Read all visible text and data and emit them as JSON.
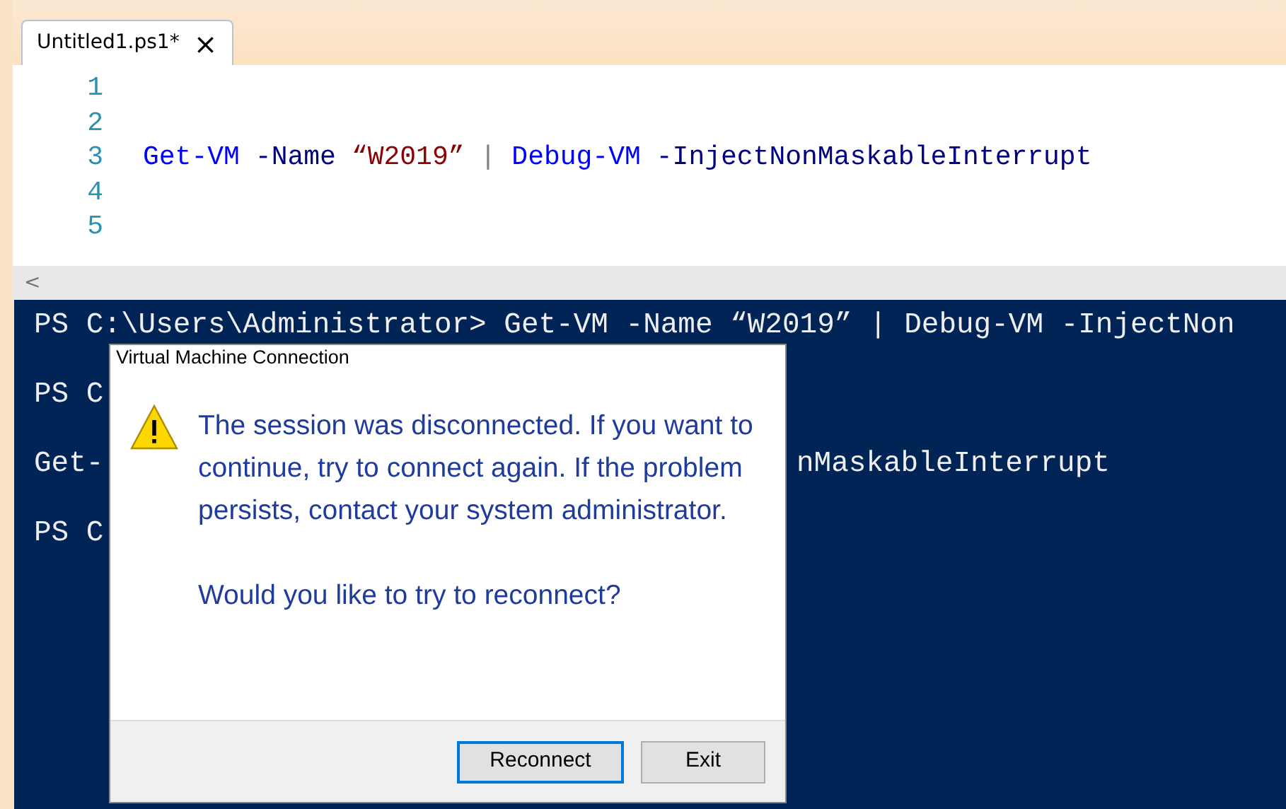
{
  "editor": {
    "tabs": [
      {
        "label": "Untitled1.ps1*",
        "close": "×",
        "selected": true
      }
    ],
    "lines": [
      {
        "number": "1"
      },
      {
        "number": "2"
      },
      {
        "number": "3",
        "tokens": [
          {
            "kind": "command",
            "text": "Get-VM"
          },
          {
            "kind": "parameter",
            "text": "-Name"
          },
          {
            "kind": "string",
            "text": "“W2019”"
          },
          {
            "kind": "operator",
            "text": "|"
          },
          {
            "kind": "command",
            "text": "Debug-VM"
          },
          {
            "kind": "parameter",
            "text": "-InjectNonMaskableInterrupt"
          }
        ]
      },
      {
        "number": "4"
      },
      {
        "number": "5"
      }
    ],
    "scroll_arrow": "<"
  },
  "console": {
    "lines": [
      {
        "left": "PS C:\\Users\\Administrator> Get-VM -Name “W2019” | Debug-VM -InjectNon"
      },
      {
        "left": "PS C"
      },
      {
        "left": "Get-",
        "right": "nMaskableInterrupt"
      },
      {
        "left": "PS C"
      }
    ]
  },
  "dialog": {
    "title": "Virtual Machine Connection",
    "message": "The session was disconnected. If you want to continue, try to connect again. If the problem persists, contact your system administrator.",
    "question": "Would you like to try to reconnect?",
    "buttons": [
      {
        "label": "Reconnect",
        "default": true
      },
      {
        "label": "Exit",
        "default": false
      }
    ]
  }
}
